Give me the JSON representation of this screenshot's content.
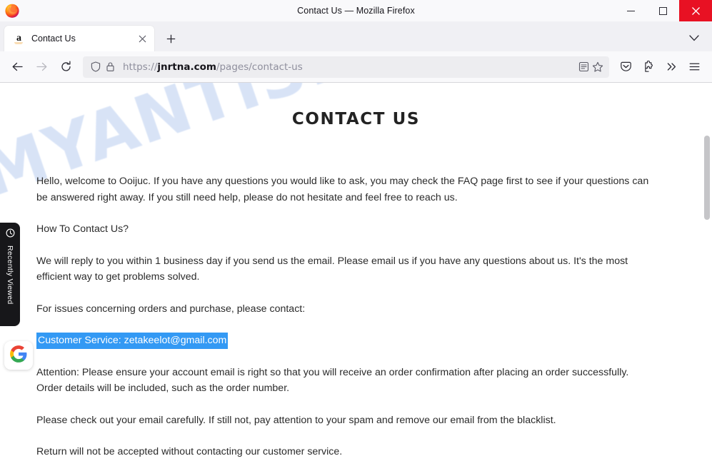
{
  "window": {
    "title": "Contact Us — Mozilla Firefox",
    "minimize_label": "Minimize",
    "maximize_label": "Maximize",
    "close_label": "Close"
  },
  "tabbar": {
    "tab": {
      "favicon_letter": "a",
      "title": "Contact Us",
      "close_label": "×"
    },
    "new_tab_label": "+",
    "list_all_tabs_label": "List all tabs"
  },
  "toolbar": {
    "back_label": "Back",
    "forward_label": "Forward",
    "reload_label": "Reload",
    "url_scheme": "https://",
    "url_host": "jnrtna.com",
    "url_path": "/pages/contact-us",
    "reader_label": "Reader View",
    "bookmark_label": "Bookmark this page",
    "pocket_label": "Save to Pocket",
    "extensions_label": "Extensions",
    "overflow_label": "More tools",
    "menu_label": "Open application menu"
  },
  "page": {
    "heading": "CONTACT US",
    "watermark": "MYANTISPYWARE.COM",
    "paragraphs": [
      "Hello, welcome to Ooijuc. If you have any questions you would like to ask, you may check the FAQ page first to see if your questions can be answered right away. If you still need help, please do not hesitate and feel free to reach us.",
      "How To Contact Us?",
      "We will reply to you within 1 business day if you send us the email. Please email us if you have any questions about us. It's the most efficient way to get problems solved.",
      "For issues concerning orders and purchase, please contact:"
    ],
    "selected_line": "Customer Service: zetakeelot@gmail.com",
    "paragraphs_after": [
      "Attention: Please ensure your account email is right so that you will receive an order confirmation after placing an order successfully. Order details will be included, such as the order number.",
      "Please check out your email carefully. If still not, pay attention to your spam and remove our email from the blacklist.",
      "Return will not be accepted without contacting our customer service."
    ],
    "selection_color": "#3399f4",
    "widgets": {
      "recently_viewed_label": "Recently Viewed",
      "google_label": "Google"
    }
  }
}
